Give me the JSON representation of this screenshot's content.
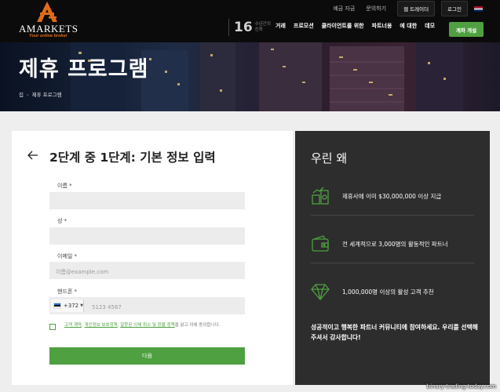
{
  "brand": {
    "name": "AMARKETS",
    "tagline": "Your online broker"
  },
  "top_bar": {
    "links": [
      "예금 자금",
      "문의하기"
    ],
    "buttons": [
      "웹 트레이더",
      "로그인"
    ],
    "language_flag_icon": "uk-flag-icon"
  },
  "years": {
    "number": "16",
    "text": "수년간의 신뢰"
  },
  "nav": {
    "items": [
      "거래",
      "프로모션",
      "클라이언트를 위한",
      "파트너용",
      "에 대한",
      "데모"
    ],
    "open_account": "계좌 개설"
  },
  "banner": {
    "title": "제휴 프로그램",
    "breadcrumb": [
      "집",
      "제휴 프로그램"
    ]
  },
  "form": {
    "title": "2단계 중 1단계: 기본 정보 입력",
    "first_name": {
      "label": "이름 *",
      "value": "",
      "placeholder": ""
    },
    "last_name": {
      "label": "성 *",
      "value": "",
      "placeholder": ""
    },
    "email": {
      "label": "이메일 *",
      "value": "",
      "placeholder": "이름@example.com"
    },
    "phone": {
      "label": "핸드폰 *",
      "code": "+372",
      "value": "",
      "placeholder": "5123 4567",
      "country_flag_icon": "estonia-flag-icon"
    },
    "consent": {
      "link_terms": "고객 계약",
      "sep1": ", ",
      "link_privacy": "개인정보 보호정책",
      "sep2": ", ",
      "link_refund": "잘못된 이체 취소 및 환불 정책",
      "suffix": "을 읽고 이에 동의합니다."
    },
    "submit_label": "다음"
  },
  "why": {
    "title": "우린 왜",
    "items": [
      {
        "icon": "money-growth-icon",
        "text": "제휴사에 이미 $30,000,000 이상 지급"
      },
      {
        "icon": "wallet-icon",
        "text": "전 세계적으로 3,000명의 활동적인 파트너"
      },
      {
        "icon": "diamond-icon",
        "text": "1,000,000명 이상의 활성 고객 추천"
      }
    ],
    "footer": "성공적이고 행복한 파트너 커뮤니티에 참여하세요. 우리를 선택해 주셔서 감사합니다!"
  },
  "watermark": "binary-trading-today.com",
  "colors": {
    "accent_green": "#4ea040",
    "brand_orange": "#e06b1a",
    "header_bg": "#0b0b0b",
    "panel_dark": "#2d2d2d"
  }
}
